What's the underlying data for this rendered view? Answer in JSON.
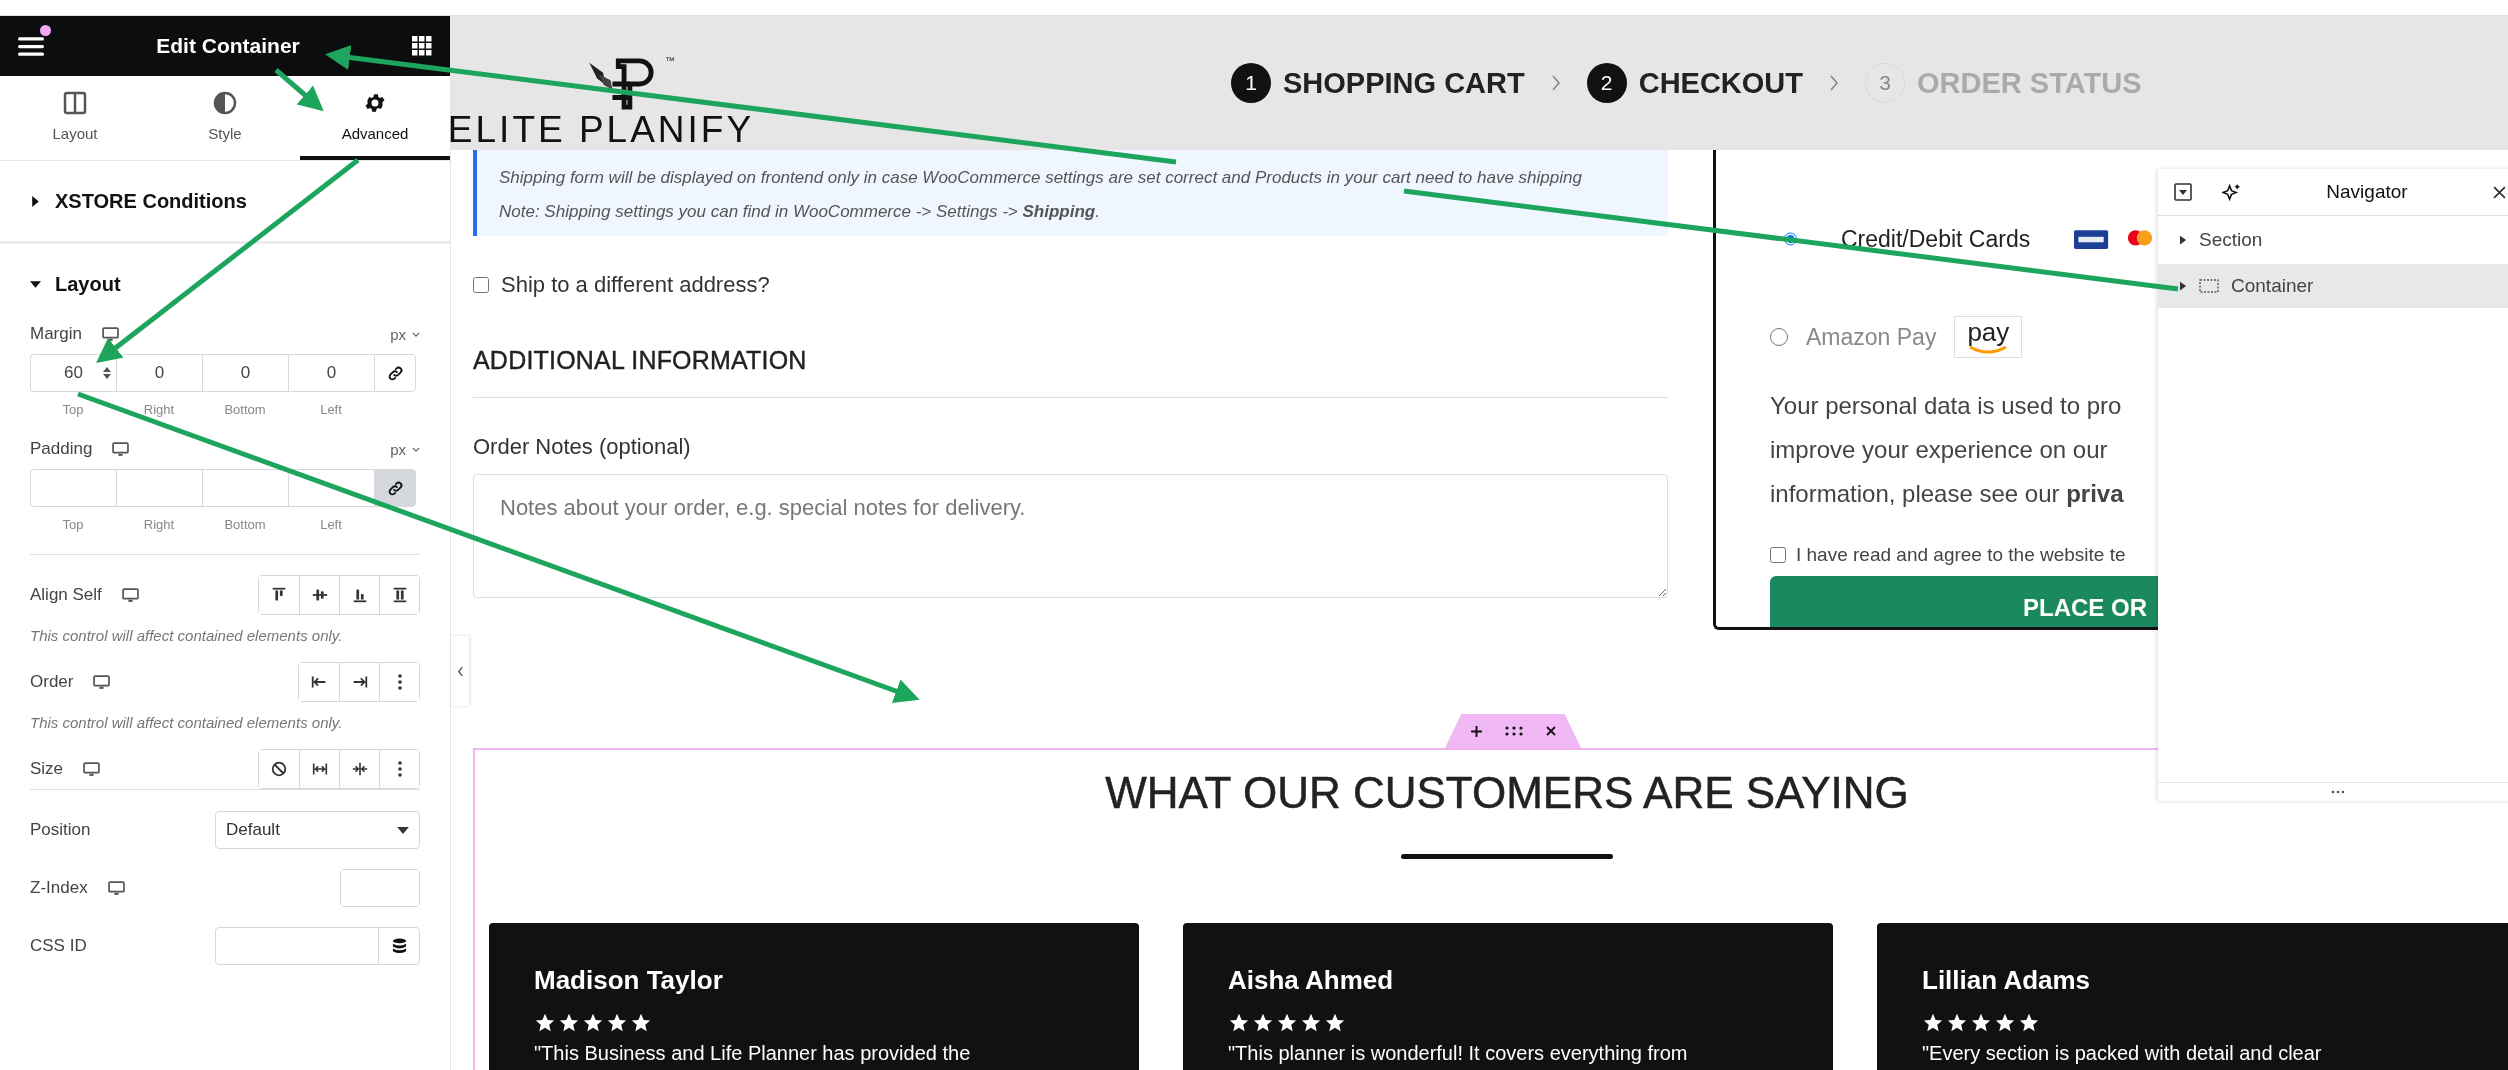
{
  "editor_panel": {
    "title": "Edit Container",
    "tabs": [
      {
        "label": "Layout",
        "selected": false
      },
      {
        "label": "Style",
        "selected": false
      },
      {
        "label": "Advanced",
        "selected": true
      }
    ],
    "sections": [
      {
        "title": "XSTORE Conditions",
        "expanded": false
      },
      {
        "title": "Layout",
        "expanded": true
      }
    ],
    "margin": {
      "label": "Margin",
      "unit": "px",
      "linked": false,
      "fields": [
        {
          "label": "Top",
          "value": "60"
        },
        {
          "label": "Right",
          "value": "0"
        },
        {
          "label": "Bottom",
          "value": "0"
        },
        {
          "label": "Left",
          "value": "0"
        }
      ]
    },
    "padding": {
      "label": "Padding",
      "unit": "px",
      "linked": true,
      "fields": [
        {
          "label": "Top"
        },
        {
          "label": "Right"
        },
        {
          "label": "Bottom"
        },
        {
          "label": "Left"
        }
      ]
    },
    "icon_controls": [
      {
        "kind": "align",
        "label": "Align Self",
        "note": "This control will affect contained elements only."
      },
      {
        "kind": "order",
        "label": "Order",
        "note": "This control will affect contained elements only."
      },
      {
        "kind": "size",
        "label": "Size"
      }
    ],
    "position": {
      "label": "Position",
      "value": "Default"
    },
    "z_index": {
      "label": "Z-Index"
    },
    "css_id": {
      "label": "CSS ID"
    }
  },
  "site_header": {
    "logo_mark": "™",
    "logo_text": "ELITE PLANIFY",
    "steps": [
      {
        "number": "1",
        "label": "SHOPPING CART",
        "active": true
      },
      {
        "number": "2",
        "label": "CHECKOUT",
        "active": true
      },
      {
        "number": "3",
        "label": "ORDER STATUS",
        "active": false
      }
    ]
  },
  "checkout": {
    "notice": [
      "Shipping form will be displayed on frontend only in case WooCommerce settings are set correct and Products in your cart need to have shipping",
      "Note: Shipping settings you can find in WooCommerce -> Settings -> **Shipping**."
    ],
    "ship_different": {
      "label": "Ship to a different address?",
      "checked": false
    },
    "heading": "ADDITIONAL INFORMATION",
    "notes_label": "Order Notes (optional)",
    "notes_placeholder": "Notes about your order, e.g. special notes for delivery."
  },
  "payment": {
    "methods": [
      {
        "label": "Credit/Debit Cards",
        "kind": "cards",
        "selected": true
      },
      {
        "label": "Amazon Pay",
        "kind": "amazon",
        "logo_text": "pay",
        "selected": false
      }
    ],
    "privacy_lines": [
      "Your personal data is used to pro",
      "improve your experience on our",
      "information, please see our **priva**"
    ],
    "terms": {
      "label": "I have read and agree to the website te",
      "checked": false
    },
    "button": "PLACE OR"
  },
  "navigator": {
    "title": "Navigator",
    "items": [
      {
        "label": "Section",
        "kind": "section",
        "selected": false
      },
      {
        "label": "Container",
        "kind": "container",
        "selected": true
      }
    ]
  },
  "testimonials": {
    "heading": "WHAT OUR CUSTOMERS ARE SAYING",
    "reviews": [
      {
        "name": "Madison Taylor",
        "stars": 5,
        "text": "\"This Business and Life Planner has provided the"
      },
      {
        "name": "Aisha Ahmed",
        "stars": 5,
        "text": "\"This planner is wonderful! It covers everything from"
      },
      {
        "name": "Lillian Adams",
        "stars": 5,
        "text": "\"Every section is packed with detail and clear"
      }
    ]
  }
}
